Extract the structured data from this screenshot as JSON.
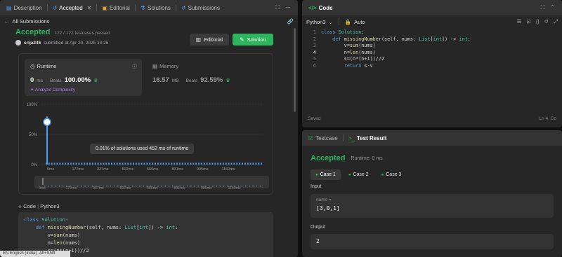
{
  "left_tabs": [
    {
      "label": "Description",
      "icon": "description-icon"
    },
    {
      "label": "Accepted",
      "icon": "history-icon"
    },
    {
      "label": "Editorial",
      "icon": "editorial-icon"
    },
    {
      "label": "Solutions",
      "icon": "flask-icon"
    },
    {
      "label": "Submissions",
      "icon": "history-icon"
    }
  ],
  "back_link": "All Submissions",
  "result": {
    "status": "Accepted",
    "passed": "122 / 122 testcases passed",
    "user": "srija246",
    "submitted_text": "submitted at Apr 20, 2025 10:25"
  },
  "buttons": {
    "editorial": "Editorial",
    "solution": "Solution"
  },
  "runtime": {
    "title": "Runtime",
    "value": "0",
    "unit": "ms",
    "beats_label": "Beats",
    "beats_value": "100.00%",
    "analyze": "Analyze Complexity"
  },
  "memory": {
    "title": "Memory",
    "value": "18.57",
    "unit": "MB",
    "beats_label": "Beats",
    "beats_value": "92.59%"
  },
  "chart_data": {
    "type": "bar",
    "ylabels": [
      "100%",
      "50%",
      "0%"
    ],
    "ylim": [
      0,
      100
    ],
    "xlabels": [
      "0ms",
      "172ms",
      "337ms",
      "502ms",
      "666ms",
      "831ms",
      "995ms",
      "1160ms"
    ],
    "mini_xlabels": [
      "0ms",
      "172ms",
      "337ms",
      "502ms",
      "666ms",
      "831ms",
      "995ms",
      "1160ms"
    ],
    "peak_value": 80,
    "tooltip": "0.01% of solutions used 452 ms of runtime",
    "accent": "#4b9cf5"
  },
  "code_section": {
    "label": "Code",
    "lang": "Python3"
  },
  "code_lines": [
    "class Solution:",
    "    def missingNumber(self, nums: List[int]) -> int:",
    "        v=sum(nums)",
    "        n=len(nums)",
    "        s=(n*(n+1))//2"
  ],
  "lang_bar": "EN English (India) ·Alt+Shift",
  "editor": {
    "title": "Code",
    "language": "Python3",
    "mode": "Auto",
    "lines": [
      "class Solution:",
      "    def missingNumber(self, nums: List[int]) -> int:",
      "        v=sum(nums)",
      "        n=len(nums)",
      "        s=(n*(n+1))//2",
      "        return s-v"
    ],
    "line_numbers": [
      "1",
      "2",
      "3",
      "4",
      "5",
      "6"
    ],
    "saved": "Saved",
    "cursor": "Ln 4, Co"
  },
  "testpanel": {
    "tab_testcase": "Testcase",
    "tab_result": "Test Result",
    "status": "Accepted",
    "runtime": "Runtime: 0 ms",
    "cases": [
      "Case 1",
      "Case 2",
      "Case 3"
    ],
    "input_label": "Input",
    "var_label": "nums =",
    "input_value": "[3,0,1]",
    "output_label": "Output",
    "output_value": "2"
  },
  "colors": {
    "accepted": "#2db55d",
    "link": "#4b9cf5",
    "analyze": "#b07bf5"
  }
}
